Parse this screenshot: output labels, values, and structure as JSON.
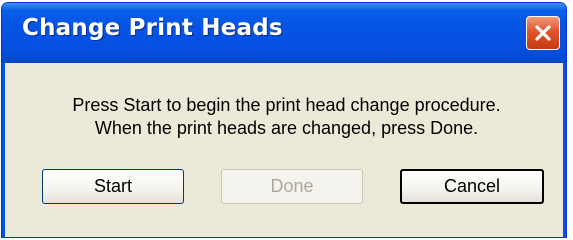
{
  "window": {
    "title": "Change Print Heads",
    "close_icon": "close-icon"
  },
  "message": {
    "line1": "Press Start to begin the print head change procedure.",
    "line2": "When the print heads are changed, press Done."
  },
  "buttons": {
    "start": "Start",
    "done": "Done",
    "cancel": "Cancel"
  },
  "colors": {
    "titlebar": "#0553e4",
    "dialog_bg": "#ece9d8",
    "close_button": "#e0552c",
    "disabled_text": "#acaa9b"
  }
}
